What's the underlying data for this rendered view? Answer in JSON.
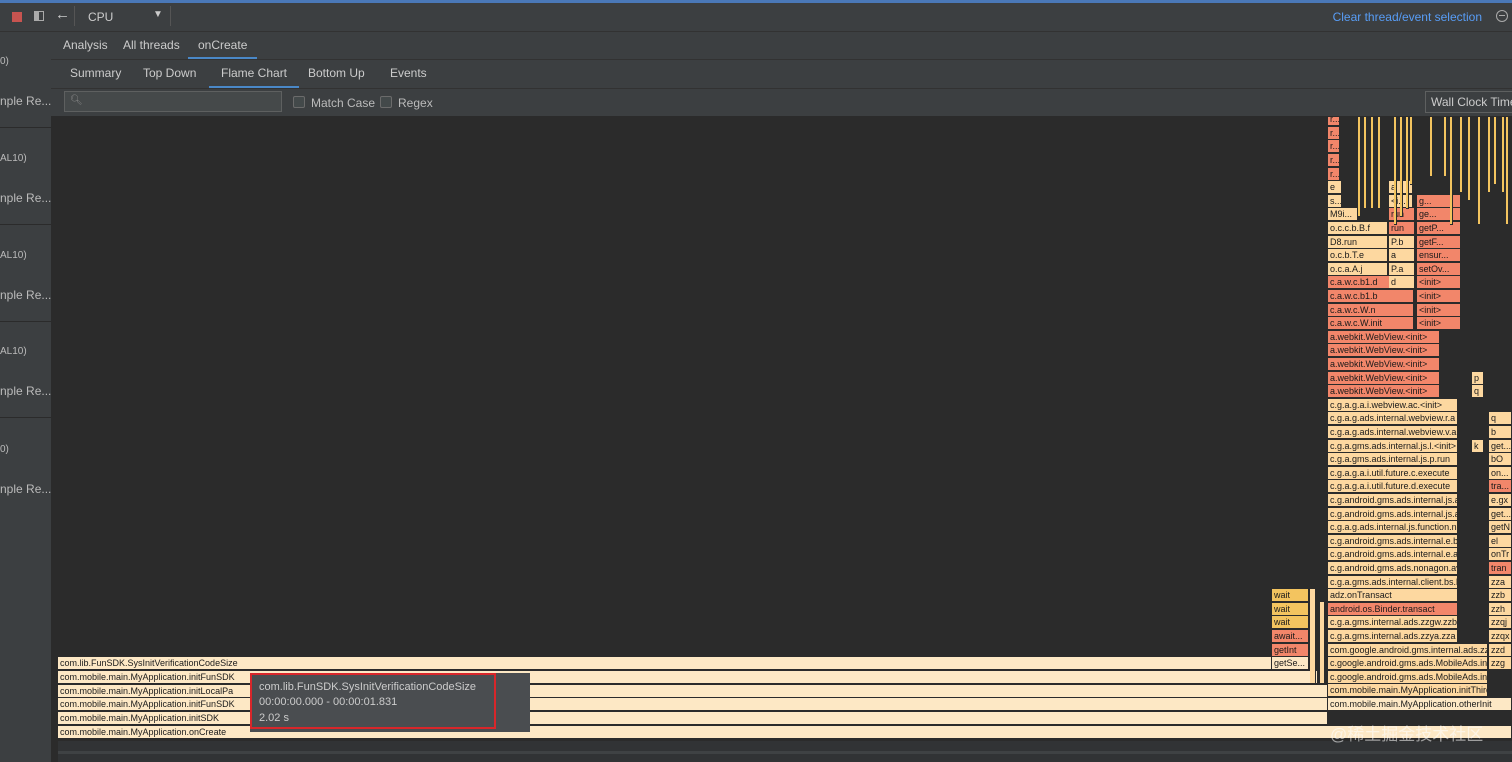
{
  "toolbar": {
    "profiler": "CPU",
    "clear_link": "Clear thread/event selection"
  },
  "sidebar": {
    "items": [
      {
        "top": "0)",
        "bottom": "nple Re..."
      },
      {
        "top": "AL10)",
        "bottom": "nple Re..."
      },
      {
        "top": "AL10)",
        "bottom": "nple Re..."
      },
      {
        "top": "AL10)",
        "bottom": "nple Re..."
      },
      {
        "top": "0)",
        "bottom": "nple Re..."
      }
    ]
  },
  "tabs_top": [
    "Analysis",
    "All threads",
    "onCreate"
  ],
  "tabs_analysis": [
    "Summary",
    "Top Down",
    "Flame Chart",
    "Bottom Up",
    "Events"
  ],
  "filter": {
    "match_case": "Match Case",
    "regex": "Regex",
    "clock": "Wall Clock Time"
  },
  "flame": {
    "bottom_frames": [
      "com.mobile.main.MyApplication.onCreate",
      "com.mobile.main.MyApplication.initSDK",
      "com.mobile.main.MyApplication.initFunSDK",
      "com.mobile.main.MyApplication.initLocalPa",
      "com.mobile.main.MyApplication.initFunSDK",
      "com.lib.FunSDK.SysInitVerificationCodeSize"
    ],
    "wait_stack": [
      "getSe...",
      "getInt",
      "await...",
      "wait",
      "wait",
      "wait"
    ],
    "right_stack": [
      "com.mobile.main.MyApplication.otherInit",
      "com.mobile.main.MyApplication.initThirdSDK",
      "c.google.android.gms.ads.MobileAds.initialize",
      "c.google.android.gms.ads.MobileAds.initialize",
      "com.google.android.gms.internal.ads.zzzj",
      "c.g.a.gms.internal.ads.zzya.zza",
      "c.g.a.gms.internal.ads.zzgw.zzb",
      "android.os.Binder.transact",
      "adz.onTransact",
      "c.g.a.gms.ads.internal.client.bs.bO",
      "c.g.android.gms.ads.nonagon.av.h",
      "c.g.android.gms.ads.internal.e.a",
      "c.g.android.gms.ads.internal.e.b",
      "c.g.a.g.ads.internal.js.function.n.b",
      "c.g.android.gms.ads.internal.js.ai.a",
      "c.g.android.gms.ads.internal.js.ai.b",
      "c.g.a.g.a.i.util.future.d.execute",
      "c.g.a.g.a.i.util.future.c.execute",
      "c.g.a.gms.ads.internal.js.p.run",
      "c.g.a.gms.ads.internal.js.l.<init>",
      "c.g.a.g.ads.internal.webview.v.a",
      "c.g.a.g.ads.internal.webview.r.a",
      "c.g.a.g.a.i.webview.ac.<init>",
      "a.webkit.WebView.<init>",
      "a.webkit.WebView.<init>",
      "a.webkit.WebView.<init>",
      "a.webkit.WebView.<init>",
      "a.webkit.WebView.<init>",
      "c.a.w.c.W.init",
      "c.a.w.c.W.n",
      "c.a.w.c.b1.b",
      "c.a.w.c.b1.d",
      "o.c.a.A.j",
      "o.c.b.T.e",
      "D8.run",
      "o.c.c.b.B.f",
      "M9i...",
      "s...",
      "e",
      "r...",
      "r...",
      "r...",
      "r...",
      "r..."
    ],
    "col2": [
      "d",
      "P.a",
      "a"
    ],
    "col2b": [
      "P.b",
      "run",
      "run"
    ],
    "col2c": [
      "<i...",
      "a"
    ],
    "col3": [
      "<init>",
      "<init>",
      "<init>",
      "<init>",
      "setOv...",
      "ensur...",
      "getF...",
      "getP...",
      "ge...",
      "g..."
    ],
    "k_frame": "k",
    "col5": [
      "zzg",
      "zzd",
      "zzqx",
      "zzqj",
      "zzh",
      "zzb",
      "zza",
      "tran",
      "onTr",
      "el",
      "getN",
      "get...",
      "e.gx",
      "tra...",
      "on...",
      "bO",
      "get...",
      "b",
      "q"
    ],
    "p_frames": [
      "p",
      "q"
    ]
  },
  "tooltip": {
    "name": "com.lib.FunSDK.SysInitVerificationCodeSize",
    "range": "00:00:00.000 - 00:00:01.831",
    "duration": "2.02 s"
  },
  "watermark": "@稀土掘金技术社区"
}
